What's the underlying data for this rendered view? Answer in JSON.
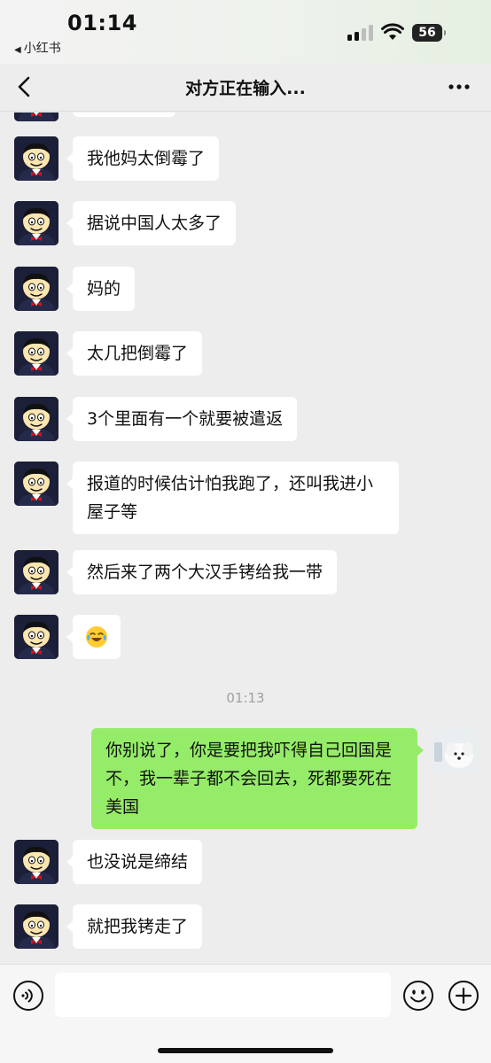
{
  "status_bar": {
    "time": "01:14",
    "back_app": "小红书",
    "battery": "56"
  },
  "nav": {
    "title": "对方正在输入..."
  },
  "messages": [
    {
      "side": "left",
      "text": "我他妈太倒霉了"
    },
    {
      "side": "left",
      "text": "据说中国人太多了"
    },
    {
      "side": "left",
      "text": "妈的"
    },
    {
      "side": "left",
      "text": "太几把倒霉了"
    },
    {
      "side": "left",
      "text": "3个里面有一个就要被遣返"
    },
    {
      "side": "left",
      "text": "报道的时候估计怕我跑了，还叫我进小屋子等"
    },
    {
      "side": "left",
      "text": "然后来了两个大汉手铐给我一带"
    },
    {
      "side": "left",
      "emoji": "crying-laughing-emoji"
    },
    {
      "timestamp": "01:13"
    },
    {
      "side": "right",
      "text": "你别说了，你是要把我吓得自己回国是不，我一辈子都不会回去，死都要死在美国"
    },
    {
      "side": "left",
      "text": "也没说是缔结"
    },
    {
      "side": "left",
      "text": "就把我铐走了"
    }
  ],
  "input": {
    "placeholder": ""
  },
  "colors": {
    "background": "#ededed",
    "incoming_bubble": "#ffffff",
    "outgoing_bubble": "#95ec69"
  }
}
